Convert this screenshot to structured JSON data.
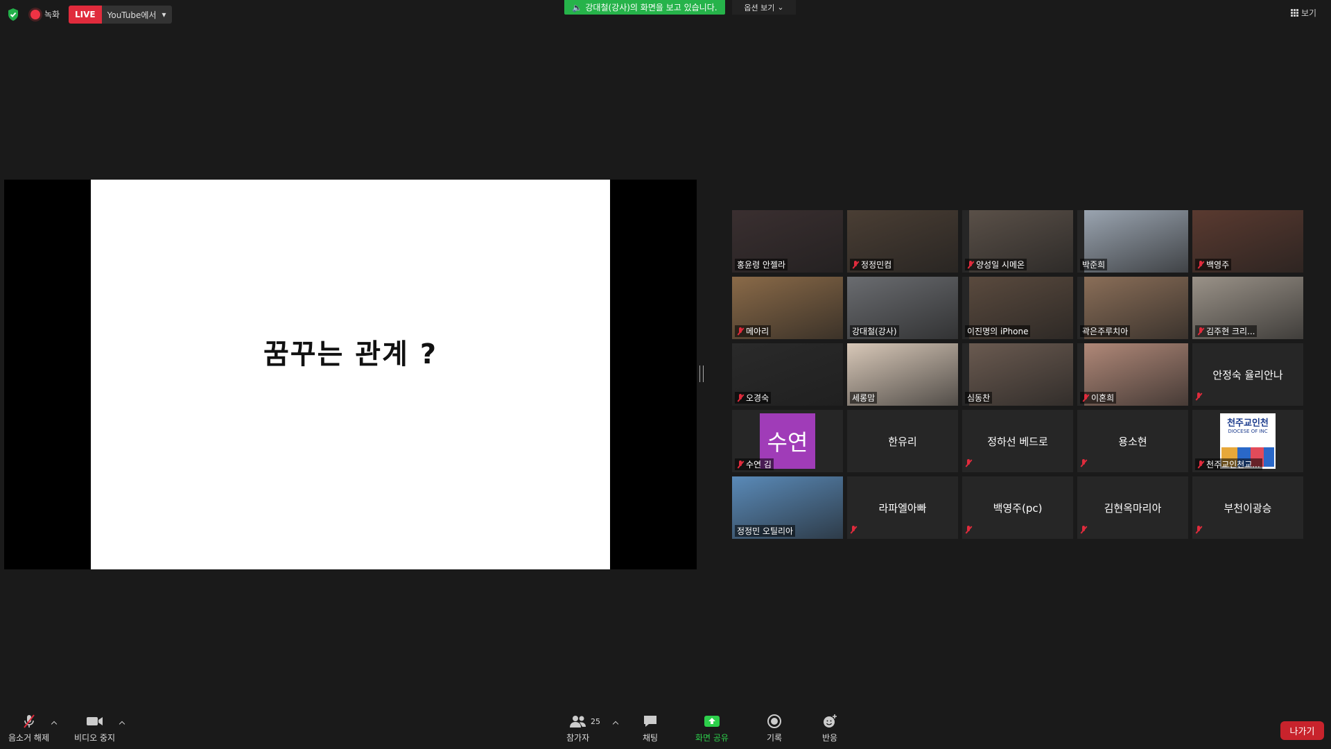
{
  "top_bar": {
    "recording_label": "녹화",
    "live_badge": "LIVE",
    "live_target": "YouTube에서",
    "viewing_banner": "강대철(강사)의 화면을 보고 있습니다.",
    "options_label": "옵션 보기",
    "view_label": "보기"
  },
  "slide": {
    "title": "꿈꾸는 관계 ?"
  },
  "participants": [
    {
      "name": "홍윤령 안젤라",
      "muted": false,
      "video": true,
      "bg": "#3a2f30"
    },
    {
      "name": "정정민컴",
      "muted": true,
      "video": true,
      "bg": "#4a3e34"
    },
    {
      "name": "양성일 시메온",
      "muted": true,
      "video": true,
      "bg": "#5a5048"
    },
    {
      "name": "박준희",
      "muted": false,
      "video": true,
      "bg": "#9aa4b0"
    },
    {
      "name": "백영주",
      "muted": true,
      "video": true,
      "bg": "#5a3a30"
    },
    {
      "name": "메아리",
      "muted": true,
      "video": true,
      "bg": "#8a6a48"
    },
    {
      "name": "강대철(강사)",
      "muted": false,
      "video": true,
      "bg": "#6a6c70",
      "active": true
    },
    {
      "name": "이진명의 iPhone",
      "muted": false,
      "video": true,
      "bg": "#5a4a3e"
    },
    {
      "name": "곽은주루치아",
      "muted": false,
      "video": true,
      "bg": "#8a6e58"
    },
    {
      "name": "김주현 크리...",
      "muted": true,
      "video": true,
      "bg": "#9a9288"
    },
    {
      "name": "오경숙",
      "muted": true,
      "video": true,
      "bg": "#2a2a2a"
    },
    {
      "name": "세롱맘",
      "muted": false,
      "video": true,
      "bg": "#d8c8b8"
    },
    {
      "name": "심동찬",
      "muted": false,
      "video": true,
      "bg": "#6a5a50"
    },
    {
      "name": "이혼희",
      "muted": true,
      "video": true,
      "bg": "#b08878"
    },
    {
      "name": "안정숙 율리안나",
      "muted": true,
      "video": false
    },
    {
      "name": "수연 김",
      "muted": true,
      "video": false,
      "avatar_text": "수연"
    },
    {
      "name": "한유리",
      "muted": false,
      "video": false
    },
    {
      "name": "정하선 베드로",
      "muted": true,
      "video": false
    },
    {
      "name": "용소현",
      "muted": true,
      "video": false
    },
    {
      "name": "천주교인천교...",
      "muted": true,
      "video": false,
      "logo_text": "천주교인천",
      "logo_sub": "DIOCESE OF INC"
    },
    {
      "name": "정정민 오틸리아",
      "muted": false,
      "video": true,
      "bg": "#5a8ab8"
    },
    {
      "name": "라파엘아빠",
      "muted": true,
      "video": false
    },
    {
      "name": "백영주(pc)",
      "muted": true,
      "video": false
    },
    {
      "name": "김현옥마리아",
      "muted": true,
      "video": false
    },
    {
      "name": "부천이광승",
      "muted": true,
      "video": false
    }
  ],
  "toolbar": {
    "unmute_label": "음소거 해제",
    "stop_video_label": "비디오 중지",
    "participants_label": "참가자",
    "participants_count": "25",
    "chat_label": "채팅",
    "share_label": "화면 공유",
    "record_label": "기록",
    "reactions_label": "반응",
    "leave_label": "나가기"
  }
}
